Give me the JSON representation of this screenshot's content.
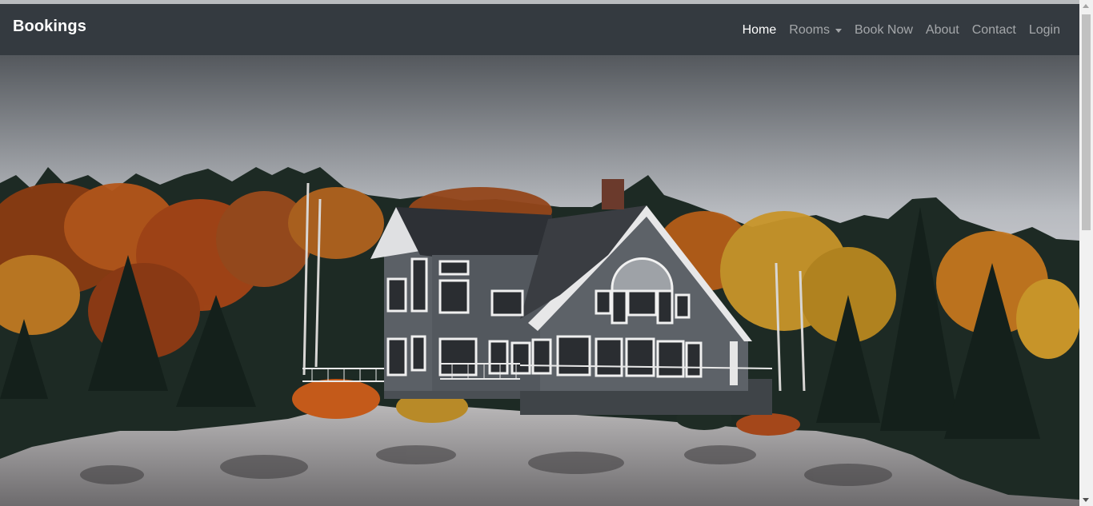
{
  "navbar": {
    "brand": "Bookings",
    "links": [
      {
        "label": "Home",
        "active": true
      },
      {
        "label": "Rooms",
        "dropdown": true
      },
      {
        "label": "Book Now"
      },
      {
        "label": "About"
      },
      {
        "label": "Contact"
      },
      {
        "label": "Login"
      }
    ],
    "background": "#343a40",
    "active_color": "#ffffff",
    "inactive_color": "rgba(255,255,255,0.55)"
  },
  "hero": {
    "image": "house-on-rocky-hill-autumn-forest",
    "sky_top": "#5b5e62",
    "sky_bottom": "#ece4ea"
  },
  "icons": {
    "rooms_dropdown": "caret-down-icon",
    "scroll_up": "scroll-up-arrow-icon",
    "scroll_down": "scroll-down-arrow-icon"
  }
}
